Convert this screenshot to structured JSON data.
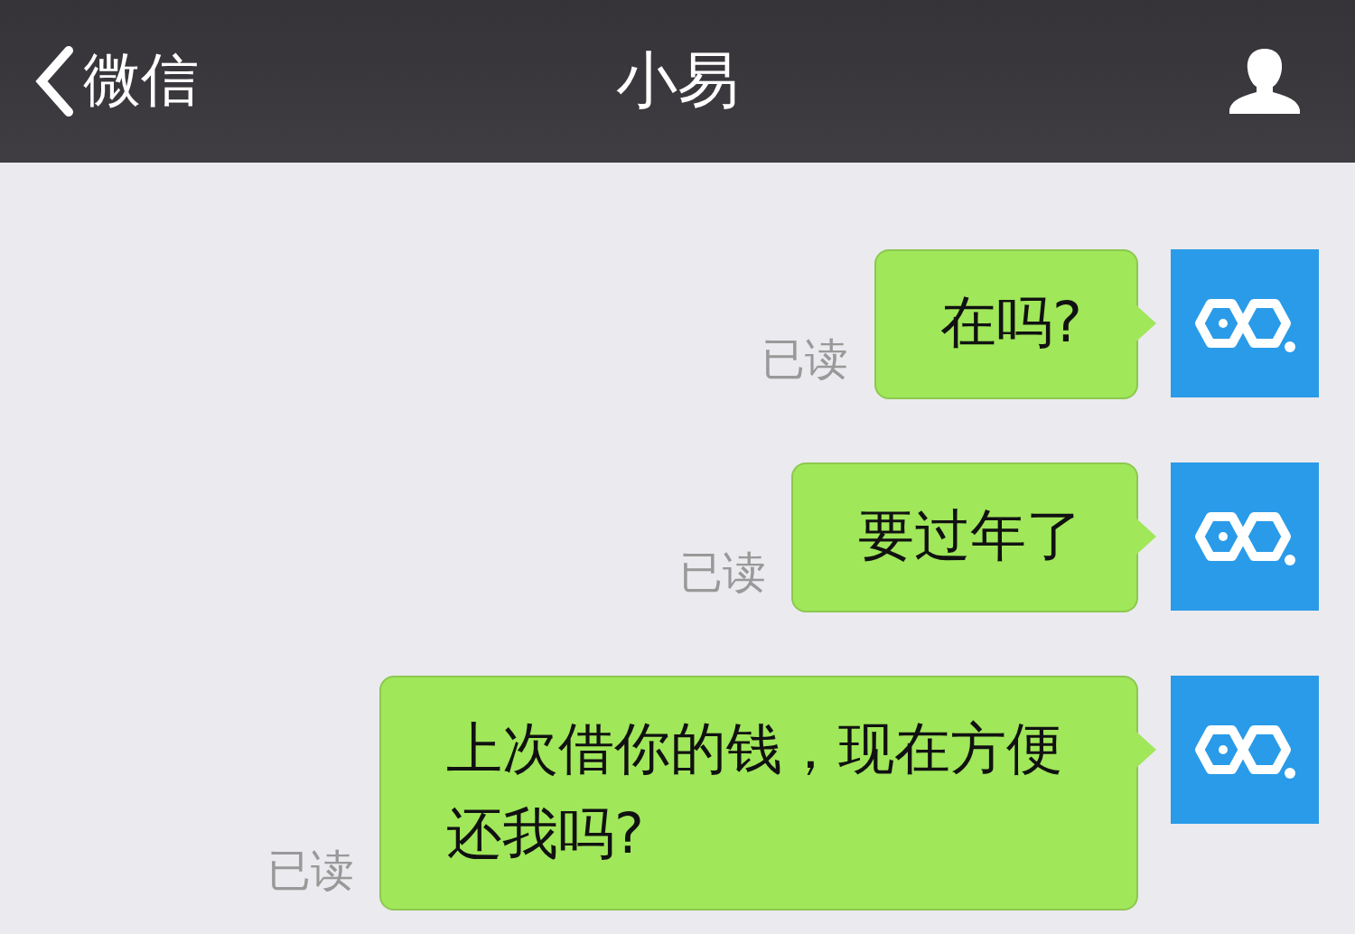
{
  "header": {
    "back_label": "微信",
    "title": "小易"
  },
  "messages": [
    {
      "text": "在吗?",
      "status": "已读",
      "outgoing": true
    },
    {
      "text": "要过年了",
      "status": "已读",
      "outgoing": true
    },
    {
      "text": "上次借你的钱，现在方便还我吗?",
      "status": "已读",
      "outgoing": true
    }
  ]
}
